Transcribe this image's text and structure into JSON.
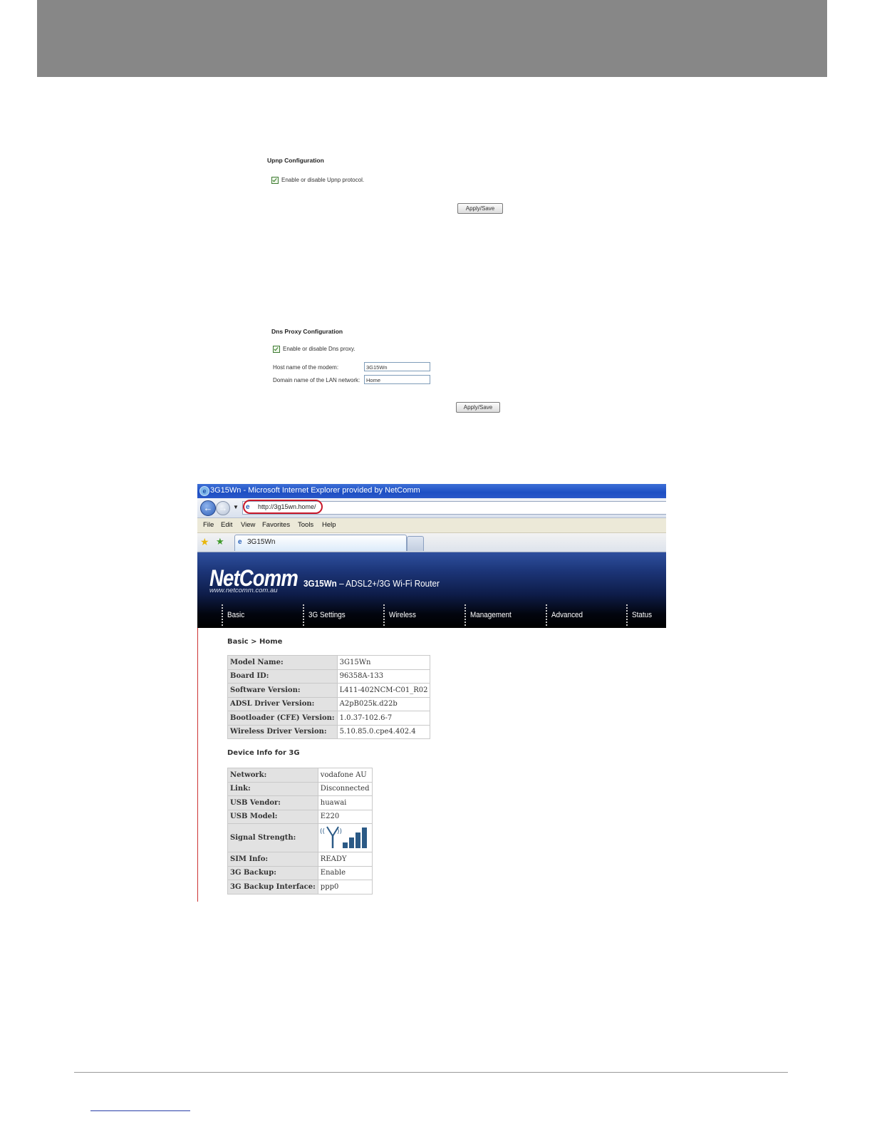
{
  "upnp": {
    "title": "Upnp Configuration",
    "checkbox_label": "Enable or disable Upnp protocol.",
    "checked": true,
    "apply_label": "Apply/Save"
  },
  "dns_proxy": {
    "title": "Dns Proxy Configuration",
    "checkbox_label": "Enable or disable Dns proxy.",
    "checked": true,
    "host_label": "Host name of the modem:",
    "host_value": "3G15Wn",
    "domain_label": "Domain name of the LAN network:",
    "domain_value": "Home",
    "apply_label": "Apply/Save"
  },
  "browser": {
    "window_title": "3G15Wn - Microsoft Internet Explorer provided by NetComm",
    "address": "http://3g15wn.home/",
    "menu": [
      "File",
      "Edit",
      "View",
      "Favorites",
      "Tools",
      "Help"
    ],
    "tab_label": "3G15Wn",
    "highlight_color": "#c8182a"
  },
  "router": {
    "brand": "NetComm",
    "brand_url": "www.netcomm.com.au",
    "model": "3G15Wn",
    "product_desc": " – ADSL2+/3G Wi-Fi Router",
    "nav": [
      "Basic",
      "3G Settings",
      "Wireless",
      "Management",
      "Advanced",
      "Status"
    ],
    "breadcrumb": "Basic > Home",
    "device_info": [
      {
        "key": "Model Name:",
        "value": "3G15Wn"
      },
      {
        "key": "Board ID:",
        "value": "96358A-133"
      },
      {
        "key": "Software Version:",
        "value": "L411-402NCM-C01_R02"
      },
      {
        "key": "ADSL Driver Version:",
        "value": "A2pB025k.d22b"
      },
      {
        "key": "Bootloader (CFE) Version:",
        "value": "1.0.37-102.6-7"
      },
      {
        "key": "Wireless Driver Version:",
        "value": "5.10.85.0.cpe4.402.4"
      }
    ],
    "device_3g_heading": "Device Info for 3G",
    "device_3g": [
      {
        "key": "Network:",
        "value": "vodafone AU"
      },
      {
        "key": "Link:",
        "value": "Disconnected"
      },
      {
        "key": "USB Vendor:",
        "value": "huawai"
      },
      {
        "key": "USB Model:",
        "value": "E220"
      },
      {
        "key": "Signal Strength:",
        "value": ""
      },
      {
        "key": "SIM Info:",
        "value": "READY"
      },
      {
        "key": "3G Backup:",
        "value": "Enable"
      },
      {
        "key": "3G Backup Interface:",
        "value": "ppp0"
      }
    ],
    "signal_bars": 4,
    "signal_color": "#2b5a86"
  }
}
